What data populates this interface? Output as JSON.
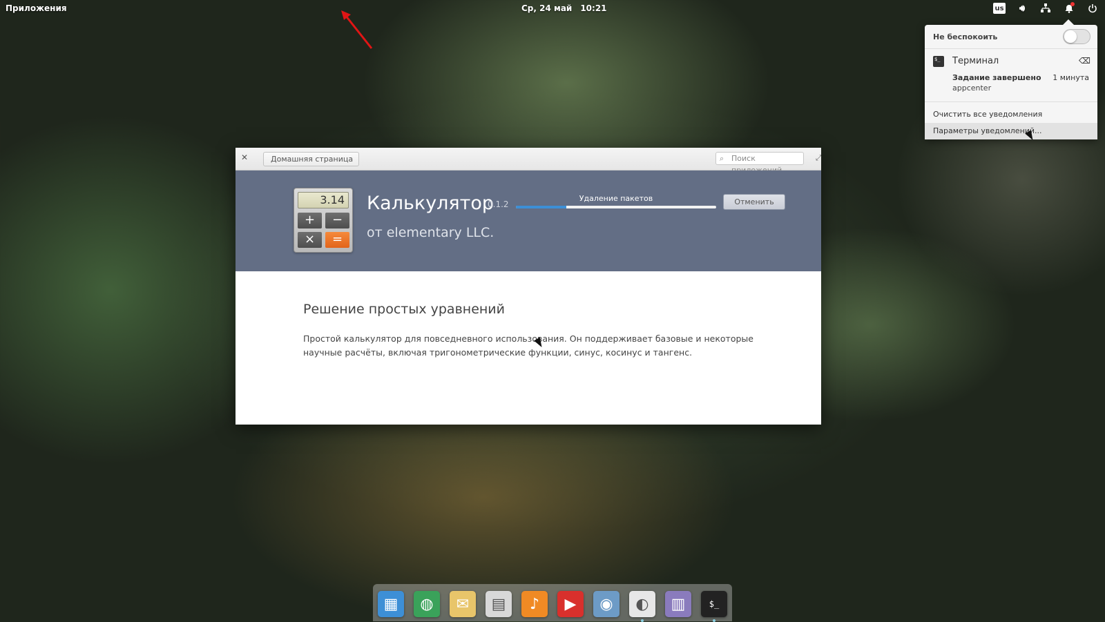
{
  "panel": {
    "applications": "Приложения",
    "date": "Ср, 24 май",
    "time": "10:21",
    "keyboard_layout": "us",
    "icons": [
      "keyboard-layout-icon",
      "volume-icon",
      "network-icon",
      "notifications-icon",
      "power-icon"
    ]
  },
  "notifications": {
    "do_not_disturb_label": "Не беспокоить",
    "do_not_disturb_enabled": false,
    "items": [
      {
        "app_name": "Терминал",
        "icon": "terminal-icon",
        "summary": "Задание завершено",
        "time": "1 минута",
        "body": "appcenter"
      }
    ],
    "clear_all": "Очистить все уведомления",
    "settings": "Параметры уведомлений..."
  },
  "window": {
    "back_button": "Домашняя страница",
    "search_placeholder": "Поиск приложений",
    "app": {
      "name": "Калькулятор",
      "version": "0.1.2",
      "author": "от elementary LLC.",
      "icon_display": "3.14",
      "progress_label": "Удаление пакетов",
      "progress_fraction": 0.25,
      "cancel_button": "Отменить"
    },
    "description": {
      "title": "Решение простых уравнений",
      "body": "Простой калькулятор для повседневного использования. Он поддерживает базовые и некоторые научные расчёты, включая тригонометрические функции, синус, косинус и тангенс."
    },
    "colors": {
      "header_bg": "#636e85",
      "progress": "#3d8fd6"
    }
  },
  "dock": {
    "items": [
      {
        "name": "multitasking-view",
        "icon": "windows-icon",
        "color": "#3d8fd6"
      },
      {
        "name": "web-browser",
        "icon": "globe-icon",
        "color": "#3aa25a"
      },
      {
        "name": "mail",
        "icon": "envelope-icon",
        "color": "#e8c56a"
      },
      {
        "name": "calendar",
        "icon": "calendar-icon",
        "color": "#d8d8d8"
      },
      {
        "name": "music",
        "icon": "music-note-icon",
        "color": "#f08a24"
      },
      {
        "name": "videos",
        "icon": "play-icon",
        "color": "#d9302c"
      },
      {
        "name": "photos",
        "icon": "camera-icon",
        "color": "#6d9bc6"
      },
      {
        "name": "system-settings",
        "icon": "toggle-icon",
        "color": "#e7e7e7"
      },
      {
        "name": "appcenter",
        "icon": "shop-icon",
        "color": "#8a7bbd"
      },
      {
        "name": "terminal",
        "icon": "terminal-icon",
        "color": "#222222"
      }
    ]
  }
}
